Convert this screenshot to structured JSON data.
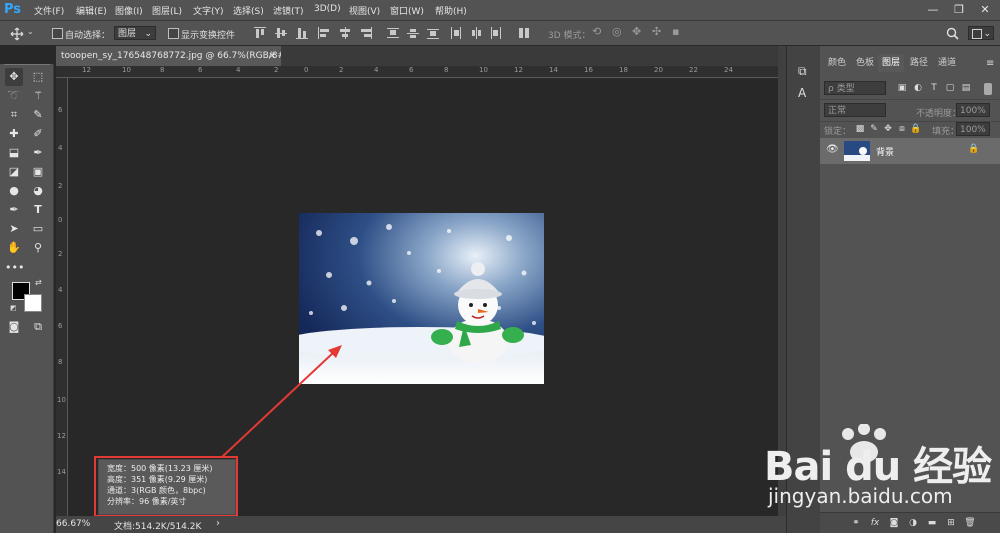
{
  "app": {
    "logo": "Ps"
  },
  "menubar": {
    "items": [
      "文件(F)",
      "编辑(E)",
      "图像(I)",
      "图层(L)",
      "文字(Y)",
      "选择(S)",
      "滤镜(T)",
      "3D(D)",
      "视图(V)",
      "窗口(W)",
      "帮助(H)"
    ],
    "minimize": "—",
    "restore": "❐",
    "close": "✕"
  },
  "options": {
    "auto_select_label": "自动选择：",
    "auto_select_value": "图层",
    "show_transform_label": "显示变换控件",
    "mode_3d_label": "3D 模式：",
    "auto_select_checked": false,
    "show_transform_checked": false
  },
  "document": {
    "tab_title": "tooopen_sy_176548768772.jpg @ 66.7%(RGB/8#) *",
    "tab_close": "×",
    "zoom": "66.67%",
    "doc_size": "文档:514.2K/514.2K",
    "status_arrow": "›"
  },
  "rulers": {
    "h_labels": [
      "12",
      "10",
      "8",
      "6",
      "4",
      "2",
      "0",
      "2",
      "4",
      "6",
      "8",
      "10",
      "12",
      "14",
      "16",
      "18",
      "20",
      "22",
      "24"
    ],
    "v_labels": [
      "6",
      "4",
      "2",
      "0",
      "2",
      "4",
      "6",
      "8",
      "10",
      "12",
      "14"
    ]
  },
  "image_info": {
    "width": "宽度：500 像素(13.23 厘米)",
    "height": "高度：351 像素(9.29 厘米)",
    "channels": "通道：3(RGB 颜色，8bpc)",
    "resolution": "分辨率：96 像素/英寸"
  },
  "panels": {
    "tabs": [
      "颜色",
      "色板",
      "图层",
      "路径",
      "通道"
    ],
    "active_tab": 2,
    "filter_label": "ρ 类型",
    "blend_mode": "正常",
    "opacity_label": "不透明度：",
    "opacity_value": "100%",
    "lock_label": "锁定：",
    "fill_label": "填充：",
    "fill_value": "100%",
    "layer_name": "背景",
    "bottom_fx": "fx"
  },
  "watermark": {
    "logo_text": "Bai du 经验",
    "url": "jingyan.baidu.com"
  },
  "colors": {
    "accent": "#31a8ff",
    "annotation": "#e53935"
  }
}
